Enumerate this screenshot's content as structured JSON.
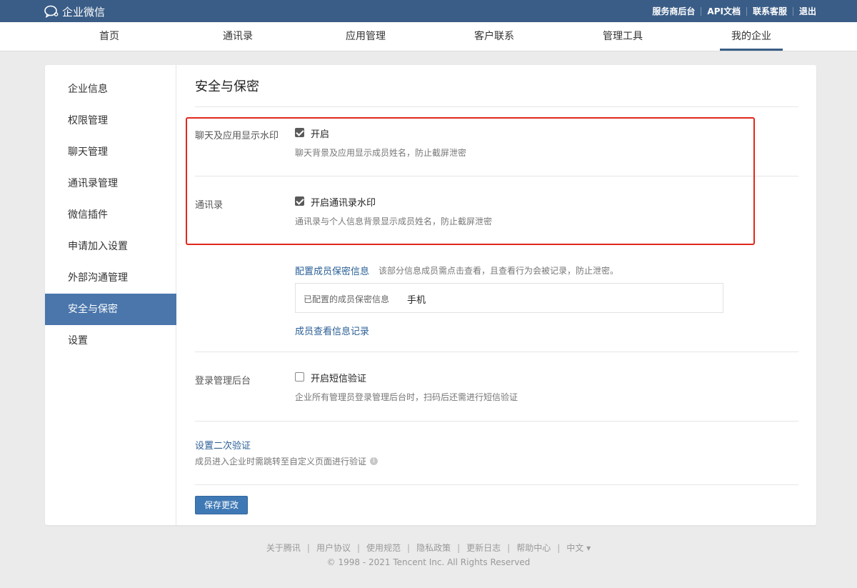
{
  "brand": {
    "name": "企业微信",
    "logo_icon": "wecom-logo-icon"
  },
  "toplinks": [
    "服务商后台",
    "API文档",
    "联系客服",
    "退出"
  ],
  "nav": {
    "tabs": [
      "首页",
      "通讯录",
      "应用管理",
      "客户联系",
      "管理工具",
      "我的企业"
    ],
    "active": "我的企业"
  },
  "sidebar": {
    "items": [
      "企业信息",
      "权限管理",
      "聊天管理",
      "通讯录管理",
      "微信插件",
      "申请加入设置",
      "外部沟通管理",
      "安全与保密",
      "设置"
    ],
    "active": "安全与保密"
  },
  "content": {
    "title": "安全与保密",
    "watermark": {
      "label": "聊天及应用显示水印",
      "option": "开启",
      "checked": true,
      "desc": "聊天背景及应用显示成员姓名，防止截屏泄密"
    },
    "contacts": {
      "label": "通讯录",
      "option": "开启通讯录水印",
      "checked": true,
      "desc": "通讯录与个人信息背景显示成员姓名，防止截屏泄密"
    },
    "secret": {
      "link": "配置成员保密信息",
      "note": "该部分信息成员需点击查看，且查看行为会被记录，防止泄密。",
      "configured_label": "已配置的成员保密信息",
      "configured_value": "手机",
      "records_link": "成员查看信息记录"
    },
    "login": {
      "label": "登录管理后台",
      "option": "开启短信验证",
      "checked": false,
      "desc": "企业所有管理员登录管理后台时，扫码后还需进行短信验证"
    },
    "second_auth": {
      "link": "设置二次验证",
      "desc": "成员进入企业时需跳转至自定义页面进行验证",
      "info_icon": "i"
    },
    "save_button": "保存更改"
  },
  "footer": {
    "links": [
      "关于腾讯",
      "用户协议",
      "使用规范",
      "隐私政策",
      "更新日志",
      "帮助中心",
      "中文 ▾"
    ],
    "copyright": "© 1998 - 2021 Tencent Inc. All Rights Reserved"
  },
  "colors": {
    "topbar": "#3a5d87",
    "active_side": "#4a76ab",
    "link": "#2a5f96",
    "highlight": "#e0281d",
    "button": "#3f79b5"
  }
}
